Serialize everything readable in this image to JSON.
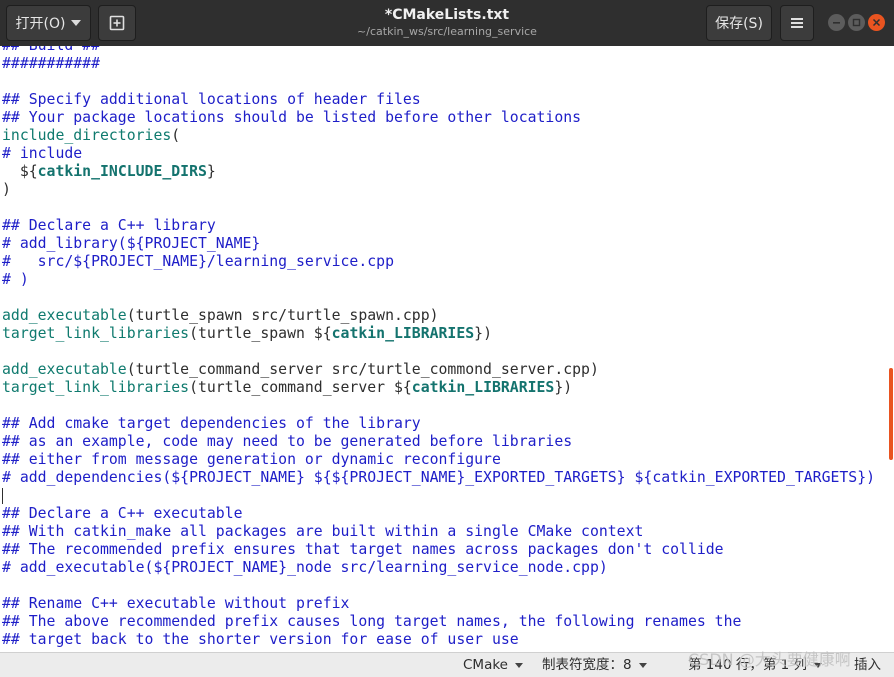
{
  "titlebar": {
    "open_label": "打开(O)",
    "title": "*CMakeLists.txt",
    "subtitle": "~/catkin_ws/src/learning_service",
    "save_label": "保存(S)"
  },
  "editor": {
    "lines": [
      [
        [
          "c",
          "## Build ##"
        ]
      ],
      [
        [
          "c",
          "###########"
        ]
      ],
      [],
      [
        [
          "c",
          "## Specify additional locations of header files"
        ]
      ],
      [
        [
          "c",
          "## Your package locations should be listed before other locations"
        ]
      ],
      [
        [
          "f",
          "include_directories"
        ],
        [
          "p",
          "("
        ]
      ],
      [
        [
          "c",
          "# include"
        ]
      ],
      [
        [
          "p",
          "  ${"
        ],
        [
          "v",
          "catkin_INCLUDE_DIRS"
        ],
        [
          "p",
          "}"
        ]
      ],
      [
        [
          "p",
          ")"
        ]
      ],
      [],
      [
        [
          "c",
          "## Declare a C++ library"
        ]
      ],
      [
        [
          "c",
          "# add_library(${PROJECT_NAME}"
        ]
      ],
      [
        [
          "c",
          "#   src/${PROJECT_NAME}/learning_service.cpp"
        ]
      ],
      [
        [
          "c",
          "# )"
        ]
      ],
      [],
      [
        [
          "f",
          "add_executable"
        ],
        [
          "p",
          "(turtle_spawn src/turtle_spawn.cpp)"
        ]
      ],
      [
        [
          "f",
          "target_link_libraries"
        ],
        [
          "p",
          "(turtle_spawn ${"
        ],
        [
          "v",
          "catkin_LIBRARIES"
        ],
        [
          "p",
          "})"
        ]
      ],
      [],
      [
        [
          "f",
          "add_executable"
        ],
        [
          "p",
          "(turtle_command_server src/turtle_commond_server.cpp)"
        ]
      ],
      [
        [
          "f",
          "target_link_libraries"
        ],
        [
          "p",
          "(turtle_command_server ${"
        ],
        [
          "v",
          "catkin_LIBRARIES"
        ],
        [
          "p",
          "})"
        ]
      ],
      [],
      [
        [
          "c",
          "## Add cmake target dependencies of the library"
        ]
      ],
      [
        [
          "c",
          "## as an example, code may need to be generated before libraries"
        ]
      ],
      [
        [
          "c",
          "## either from message generation or dynamic reconfigure"
        ]
      ],
      [
        [
          "c",
          "# add_dependencies(${PROJECT_NAME} ${${PROJECT_NAME}_EXPORTED_TARGETS} ${catkin_EXPORTED_TARGETS})"
        ]
      ],
      [],
      [
        [
          "c",
          "## Declare a C++ executable"
        ]
      ],
      [
        [
          "c",
          "## With catkin_make all packages are built within a single CMake context"
        ]
      ],
      [
        [
          "c",
          "## The recommended prefix ensures that target names across packages don't collide"
        ]
      ],
      [
        [
          "c",
          "# add_executable(${PROJECT_NAME}_node src/learning_service_node.cpp)"
        ]
      ],
      [],
      [
        [
          "c",
          "## Rename C++ executable without prefix"
        ]
      ],
      [
        [
          "c",
          "## The above recommended prefix causes long target names, the following renames the"
        ]
      ],
      [
        [
          "c",
          "## target back to the shorter version for ease of user use"
        ]
      ]
    ],
    "cursor_line": 25
  },
  "statusbar": {
    "language": "CMake",
    "tab_width": "制表符宽度：8",
    "position": "第 140 行，第 1 列",
    "mode": "插入"
  },
  "watermark": "CSDN @大头要健康啊",
  "colors": {
    "comment": "#1e1ec8",
    "function": "#0f7a6e",
    "variable": "#14736e",
    "accent": "#e95420"
  },
  "icons": [
    "chevron-down-icon",
    "new-document-icon",
    "hamburger-menu-icon",
    "minimize-icon",
    "maximize-icon",
    "close-icon"
  ]
}
